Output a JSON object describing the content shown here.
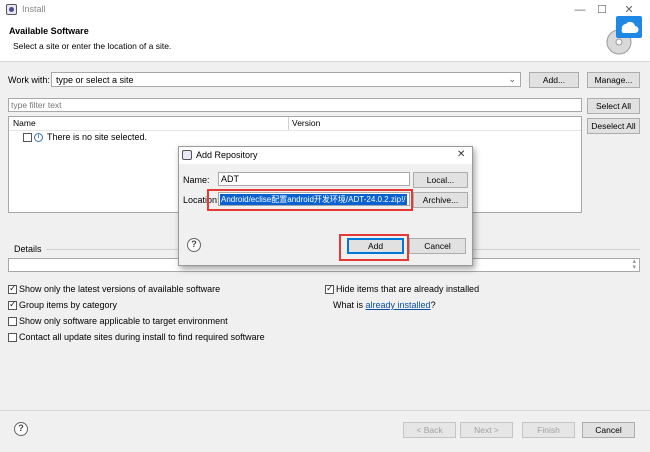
{
  "window": {
    "title": "Install",
    "minimize_icon": "—",
    "maximize_icon": "☐",
    "close_icon": "✕"
  },
  "header": {
    "title": "Available Software",
    "subtitle": "Select a site or enter the location of a site."
  },
  "work_with": {
    "label": "Work with:",
    "value": "type or select a site",
    "add_label": "Add...",
    "manage_label": "Manage..."
  },
  "filter": {
    "placeholder": "type filter text",
    "select_all_label": "Select All",
    "deselect_all_label": "Deselect All"
  },
  "tree": {
    "columns": [
      "Name",
      "Version"
    ],
    "rows": [
      {
        "text": "There is no site selected."
      }
    ]
  },
  "details": {
    "label": "Details"
  },
  "options": {
    "left": [
      {
        "label": "Show only the latest versions of available software",
        "checked": true
      },
      {
        "label": "Group items by category",
        "checked": true
      },
      {
        "label": "Show only software applicable to target environment",
        "checked": false
      },
      {
        "label": "Contact all update sites during install to find required software",
        "checked": false
      }
    ],
    "right": [
      {
        "label": "Hide items that are already installed",
        "checked": true
      }
    ],
    "what_is_prefix": "What is ",
    "what_is_link": "already installed",
    "what_is_suffix": "?"
  },
  "dialog": {
    "title": "Add Repository",
    "name_label": "Name:",
    "name_value": "ADT",
    "local_label": "Local...",
    "location_label": "Location:",
    "location_value": "Android/eclise配置android开发环境/ADT-24.0.2.zip!/",
    "archive_label": "Archive...",
    "add_label": "Add",
    "cancel_label": "Cancel",
    "close_icon": "✕"
  },
  "footer": {
    "back_label": "< Back",
    "next_label": "Next >",
    "finish_label": "Finish",
    "cancel_label": "Cancel"
  },
  "colors": {
    "highlight_red": "#e53935",
    "selection_blue": "#0a62d0",
    "link_blue": "#0b4fa8"
  }
}
